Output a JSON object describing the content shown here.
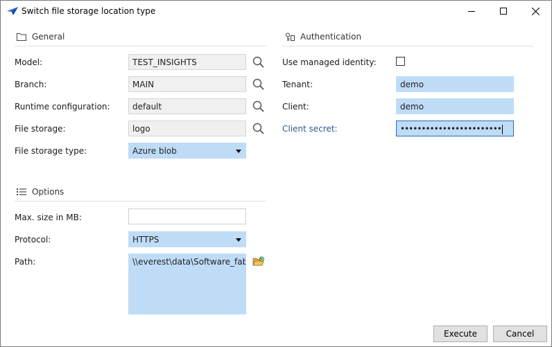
{
  "window": {
    "title": "Switch file storage location type",
    "minimize_label": "Minimize",
    "maximize_label": "Maximize",
    "close_label": "Close"
  },
  "general": {
    "heading": "General",
    "model": {
      "label": "Model:",
      "value": "TEST_INSIGHTS"
    },
    "branch": {
      "label": "Branch:",
      "value": "MAIN"
    },
    "runtime": {
      "label": "Runtime configuration:",
      "value": "default"
    },
    "file_storage": {
      "label": "File storage:",
      "value": "logo"
    },
    "file_storage_type": {
      "label": "File storage type:",
      "value": "Azure blob"
    }
  },
  "authentication": {
    "heading": "Authentication",
    "managed_identity": {
      "label": "Use managed identity:",
      "checked": false
    },
    "tenant": {
      "label": "Tenant:",
      "value": "demo"
    },
    "client": {
      "label": "Client:",
      "value": "demo"
    },
    "client_secret": {
      "label": "Client secret:",
      "value": "••••••••••••••••••••••••"
    }
  },
  "options": {
    "heading": "Options",
    "max_size": {
      "label": "Max. size in MB:",
      "value": ""
    },
    "protocol": {
      "label": "Protocol:",
      "value": "HTTPS"
    },
    "path": {
      "label": "Path:",
      "value": "\\\\everest\\data\\Software_fabriek"
    }
  },
  "buttons": {
    "execute": "Execute",
    "cancel": "Cancel"
  },
  "colors": {
    "editable_field": "#bfdcf7",
    "readonly_field": "#f0f0f0",
    "link_label": "#2a5a8a",
    "focus_border": "#2b6cb0"
  }
}
